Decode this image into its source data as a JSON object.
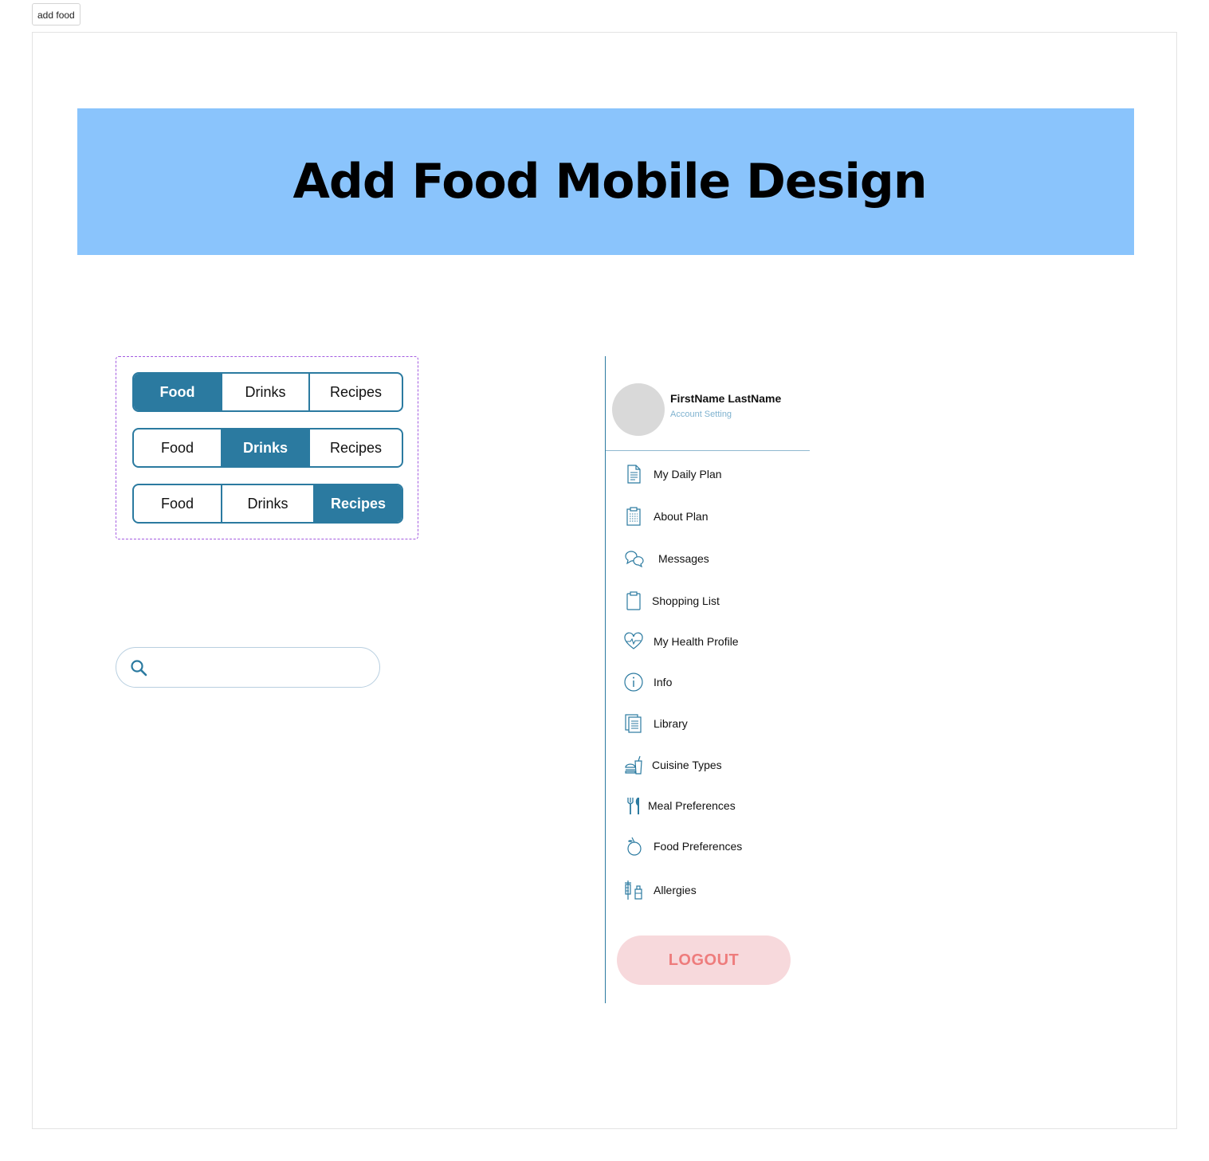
{
  "chip": {
    "label": "add food"
  },
  "banner": {
    "title": "Add Food Mobile Design"
  },
  "segmented_controls": [
    {
      "options": [
        "Food",
        "Drinks",
        "Recipes"
      ],
      "active": "Food"
    },
    {
      "options": [
        "Food",
        "Drinks",
        "Recipes"
      ],
      "active": "Drinks"
    },
    {
      "options": [
        "Food",
        "Drinks",
        "Recipes"
      ],
      "active": "Recipes"
    }
  ],
  "search": {
    "value": "",
    "placeholder": "",
    "icon": "search-icon"
  },
  "profile": {
    "name": "FirstName LastName",
    "link": "Account Setting"
  },
  "menu": {
    "items": [
      {
        "label": "My Daily Plan",
        "icon": "document-icon"
      },
      {
        "label": "About Plan",
        "icon": "clipboard-icon"
      },
      {
        "label": "Messages",
        "icon": "chat-bubbles-icon"
      },
      {
        "label": "Shopping List",
        "icon": "clipboard-empty-icon"
      },
      {
        "label": "My Health Profile",
        "icon": "heart-pulse-icon"
      },
      {
        "label": "Info",
        "icon": "info-icon"
      },
      {
        "label": "Library",
        "icon": "library-icon"
      },
      {
        "label": "Cuisine Types",
        "icon": "burger-drink-icon"
      },
      {
        "label": "Meal Preferences",
        "icon": "fork-knife-icon"
      },
      {
        "label": "Food Preferences",
        "icon": "apple-icon"
      },
      {
        "label": "Allergies",
        "icon": "syringe-bottle-icon"
      }
    ]
  },
  "logout": {
    "label": "LOGOUT"
  },
  "colors": {
    "accent": "#2b7aa0",
    "banner": "#8ac4fc",
    "logout_bg": "#f7d9dc",
    "logout_text": "#ee7c7c",
    "segment_frame": "#a35be0"
  }
}
